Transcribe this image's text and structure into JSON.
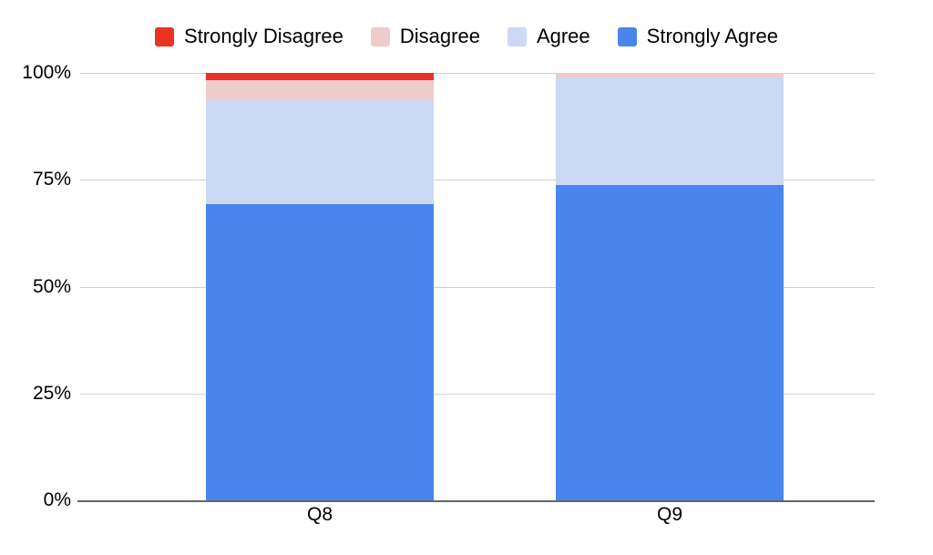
{
  "chart_data": {
    "type": "bar",
    "subtype": "stacked-bar-100-percent",
    "title": "",
    "subtitle": "",
    "xlabel": "",
    "ylabel": "",
    "categories": [
      "Q8",
      "Q9"
    ],
    "ylim": [
      0,
      100
    ],
    "yticks": [
      0,
      25,
      50,
      75,
      100
    ],
    "ytick_labels": [
      "0%",
      "25%",
      "50%",
      "75%",
      "100%"
    ],
    "grid": true,
    "grid_axis": "y",
    "legend_position": "top-center",
    "stack_order_bottom_to_top": [
      "Strongly Agree",
      "Agree",
      "Disagree",
      "Strongly Disagree"
    ],
    "series": [
      {
        "name": "Strongly Disagree",
        "color": "#EA3323",
        "values": [
          1.7,
          0.0
        ]
      },
      {
        "name": "Disagree",
        "color": "#EECCCB",
        "values": [
          4.7,
          1.1
        ]
      },
      {
        "name": "Agree",
        "color": "#CCD9F5",
        "values": [
          24.3,
          25.1
        ]
      },
      {
        "name": "Strongly Agree",
        "color": "#4A85ED",
        "values": [
          69.3,
          73.8
        ]
      }
    ]
  },
  "legend": {
    "items": [
      {
        "label": "Strongly Disagree",
        "color": "#EA3323"
      },
      {
        "label": "Disagree",
        "color": "#EECCCB"
      },
      {
        "label": "Agree",
        "color": "#CCD9F5"
      },
      {
        "label": "Strongly Agree",
        "color": "#4A85ED"
      }
    ]
  },
  "axes": {
    "y": {
      "ticks": [
        "100%",
        "75%",
        "50%",
        "25%",
        "0%"
      ]
    },
    "x": {
      "ticks": [
        "Q8",
        "Q9"
      ]
    }
  },
  "colors": {
    "strongly_disagree": "#EA3323",
    "disagree": "#EECCCB",
    "agree": "#CCD9F5",
    "strongly_agree": "#4A85ED",
    "gridline": "#D0D0D0",
    "axis": "#666666",
    "background": "#FFFFFF",
    "text": "#000000"
  }
}
